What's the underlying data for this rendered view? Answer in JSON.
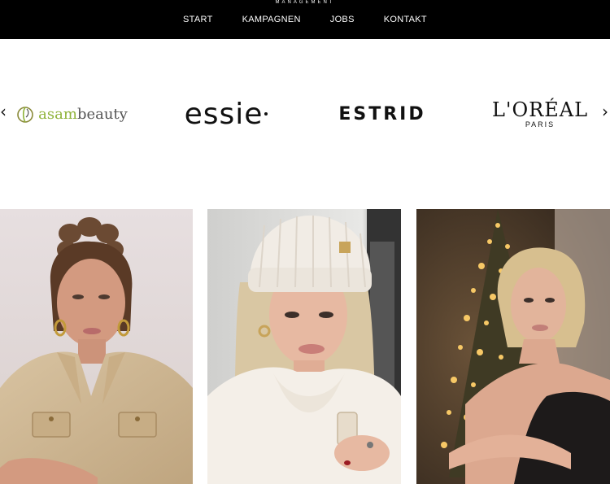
{
  "header": {
    "brand_strip": "MANAGEMENT",
    "nav": [
      {
        "label": "START"
      },
      {
        "label": "KAMPAGNEN"
      },
      {
        "label": "JOBS"
      },
      {
        "label": "KONTAKT"
      }
    ]
  },
  "carousel": {
    "prev_icon": "chevron-left-icon",
    "next_icon": "chevron-right-icon",
    "prev_glyph": "‹",
    "next_glyph": "›",
    "logos": [
      {
        "name": "asambeauty",
        "prefix": "asam",
        "suffix": "beauty"
      },
      {
        "name": "essie",
        "text": "essie"
      },
      {
        "name": "ESTRID",
        "text": "ESTRID"
      },
      {
        "name": "L'ORÉAL PARIS",
        "main": "L'ORÉAL",
        "sub": "PARIS"
      }
    ]
  },
  "gallery": {
    "photos": [
      {
        "name": "model-photo-braids"
      },
      {
        "name": "model-photo-beanie"
      },
      {
        "name": "model-photo-christmas-tree"
      }
    ]
  },
  "colors": {
    "header_bg": "#000000",
    "accent_green": "#8fb33a"
  }
}
